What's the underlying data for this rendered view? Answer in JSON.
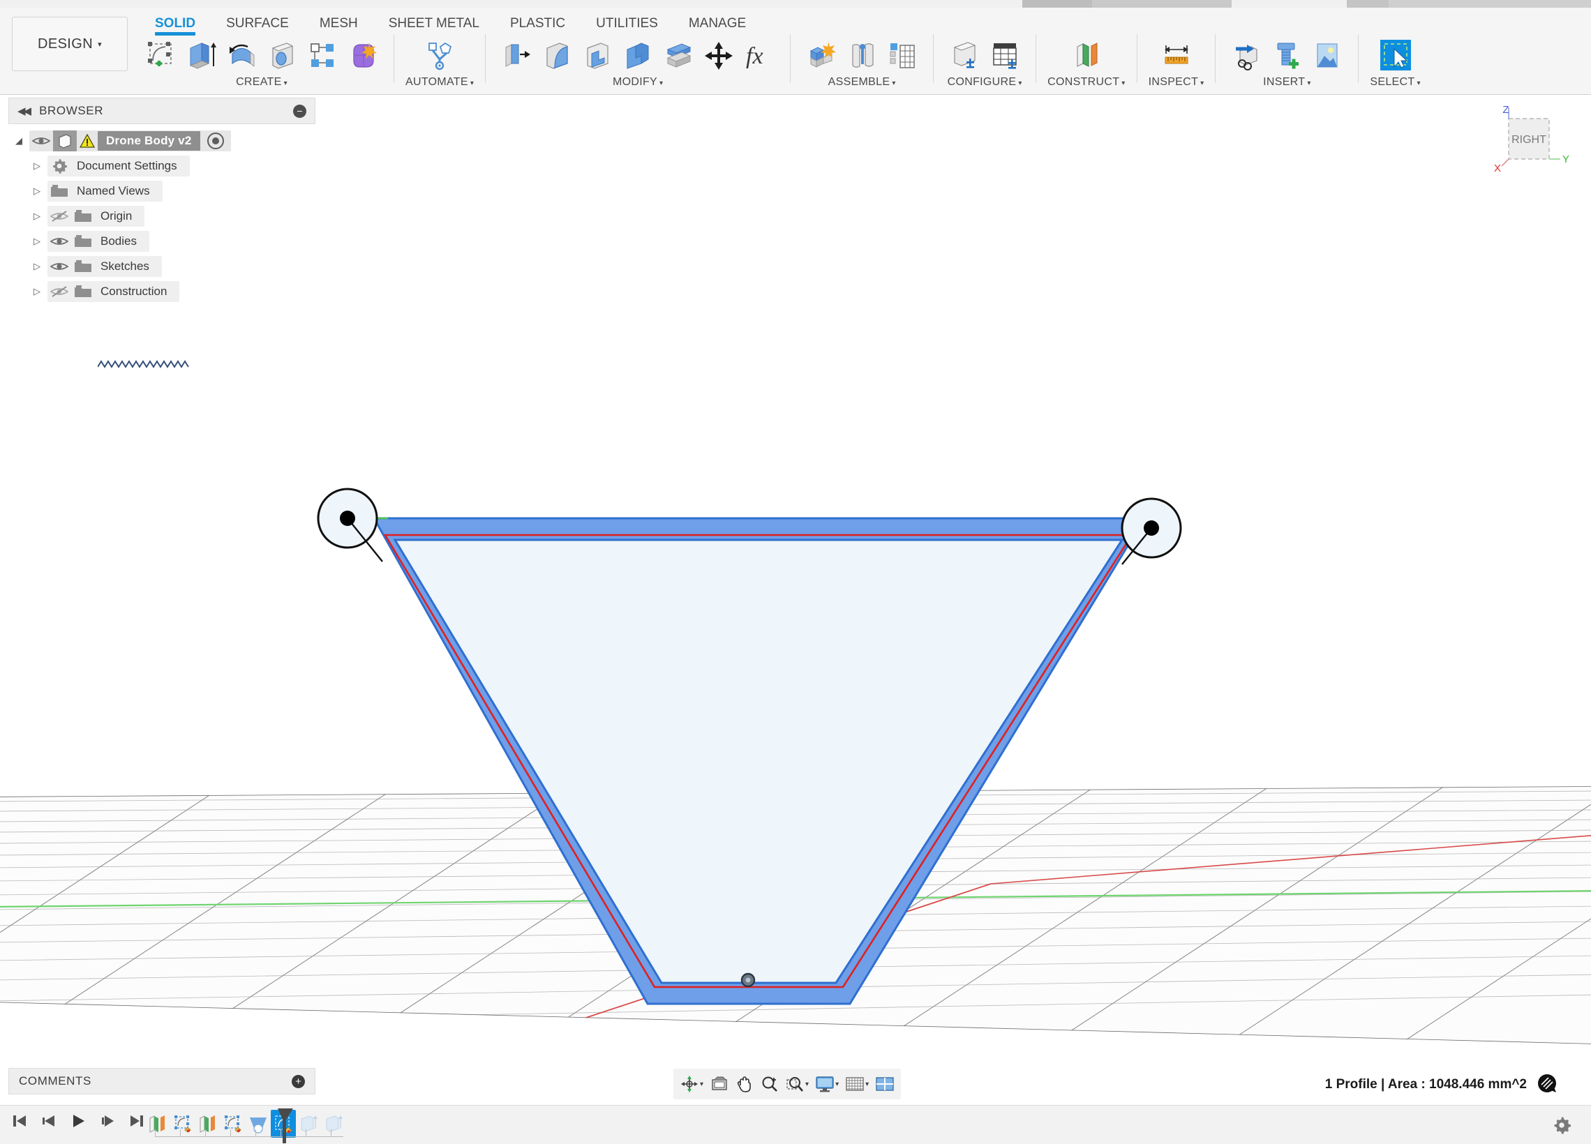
{
  "app": {
    "workspace_label": "DESIGN",
    "caret": "▾"
  },
  "ribbon": {
    "tabs": [
      {
        "label": "SOLID",
        "active": true
      },
      {
        "label": "SURFACE",
        "active": false
      },
      {
        "label": "MESH",
        "active": false
      },
      {
        "label": "SHEET METAL",
        "active": false
      },
      {
        "label": "PLASTIC",
        "active": false
      },
      {
        "label": "UTILITIES",
        "active": false
      },
      {
        "label": "MANAGE",
        "active": false
      }
    ],
    "groups": [
      {
        "label": "CREATE",
        "caret": "▾",
        "icons": [
          "create-sketch-icon",
          "extrude-icon",
          "revolve-icon",
          "hole-icon",
          "rectangular-pattern-icon",
          "form-icon"
        ]
      },
      {
        "label": "AUTOMATE",
        "caret": "▾",
        "icons": [
          "automate-icon"
        ]
      },
      {
        "label": "MODIFY",
        "caret": "▾",
        "icons": [
          "press-pull-icon",
          "fillet-icon",
          "shell-icon",
          "combine-icon",
          "offset-face-icon",
          "move-copy-icon",
          "change-parameters-icon"
        ]
      },
      {
        "label": "ASSEMBLE",
        "caret": "▾",
        "icons": [
          "new-component-icon",
          "joint-icon",
          "motion-study-icon"
        ]
      },
      {
        "label": "CONFIGURE",
        "caret": "▾",
        "icons": [
          "configure-part-icon",
          "configure-table-icon"
        ]
      },
      {
        "label": "CONSTRUCT",
        "caret": "▾",
        "icons": [
          "offset-plane-icon"
        ]
      },
      {
        "label": "INSPECT",
        "caret": "▾",
        "icons": [
          "measure-icon"
        ]
      },
      {
        "label": "INSERT",
        "caret": "▾",
        "icons": [
          "insert-derive-icon",
          "insert-mcmaster-icon",
          "insert-canvas-icon"
        ]
      },
      {
        "label": "SELECT",
        "caret": "▾",
        "icons": [
          "select-window-icon"
        ]
      }
    ]
  },
  "browser": {
    "title": "BROWSER",
    "collapse_icon": "collapse-left-icon",
    "minus_icon": "minus-icon",
    "root": {
      "name": "Drone Body v2",
      "eye_icon": "eye-visible-icon",
      "component_icon": "component-icon",
      "warning_icon": "warning-triangle-icon",
      "activate_icon": "activate-radio-icon",
      "twisty": "◢"
    },
    "items": [
      {
        "label": "Document Settings",
        "icon": "gear-icon",
        "twisty": "▷",
        "eye": "none",
        "visible": true
      },
      {
        "label": "Named Views",
        "icon": "folder-icon",
        "twisty": "▷",
        "eye": "none",
        "visible": true
      },
      {
        "label": "Origin",
        "icon": "folder-icon",
        "twisty": "▷",
        "eye": "eye-hidden-icon",
        "visible": false
      },
      {
        "label": "Bodies",
        "icon": "folder-icon",
        "twisty": "▷",
        "eye": "eye-visible-icon",
        "visible": true
      },
      {
        "label": "Sketches",
        "icon": "folder-icon",
        "twisty": "▷",
        "eye": "eye-visible-icon",
        "visible": true
      },
      {
        "label": "Construction",
        "icon": "folder-icon",
        "twisty": "▷",
        "eye": "eye-hidden-icon",
        "visible": false
      }
    ]
  },
  "viewcube": {
    "face_label": "RIGHT",
    "axis_z": "Z",
    "axis_y": "Y",
    "axis_x": "X",
    "axis_z_color": "#4a5fd0",
    "axis_y_color": "#35b835",
    "axis_x_color": "#e03030"
  },
  "comments": {
    "title": "COMMENTS",
    "add_icon": "plus-icon"
  },
  "navbar": {
    "buttons": [
      {
        "name": "orbit-icon",
        "caret": true
      },
      {
        "name": "look-at-icon",
        "caret": false
      },
      {
        "name": "pan-hand-icon",
        "caret": false
      },
      {
        "name": "zoom-in-icon",
        "caret": false
      },
      {
        "name": "zoom-window-icon",
        "caret": true
      },
      {
        "name": "display-settings-icon",
        "caret": true
      },
      {
        "name": "grid-snaps-icon",
        "caret": true
      },
      {
        "name": "viewports-icon",
        "caret": false
      }
    ]
  },
  "status": {
    "text": "1 Profile | Area : 1048.446 mm^2",
    "badge_icon": "section-analysis-icon"
  },
  "timeline": {
    "playback": [
      "jump-start-icon",
      "step-back-icon",
      "play-icon",
      "step-forward-icon",
      "jump-end-icon"
    ],
    "features": [
      {
        "name": "plane-feature-icon",
        "selected": false
      },
      {
        "name": "sketch-feature-icon",
        "selected": false
      },
      {
        "name": "plane-feature-icon",
        "selected": false
      },
      {
        "name": "sketch-feature-icon",
        "selected": false
      },
      {
        "name": "loft-feature-icon",
        "selected": false
      },
      {
        "name": "sketch-edit-icon",
        "selected": true
      },
      {
        "name": "extrude-ghost-icon",
        "selected": false
      },
      {
        "name": "extrude-ghost-icon",
        "selected": false
      }
    ],
    "settings_icon": "gear-icon"
  },
  "canvas": {
    "sketch": {
      "profile_fill": "#eef5fb",
      "band_fill": "#6f9fe8",
      "band_stroke": "#2f6fd0",
      "inner_stroke": "#e02020",
      "circle_fill": "#eef5fb",
      "circle_stroke": "#101010",
      "point_color": "#000000",
      "constraint_color": "#4fc94f",
      "origin_point_color": "#5c6a78",
      "grid_line_color": "#9a9a9a",
      "x_axis_color": "#d84a4a",
      "y_axis_color": "#6fd46f"
    }
  }
}
